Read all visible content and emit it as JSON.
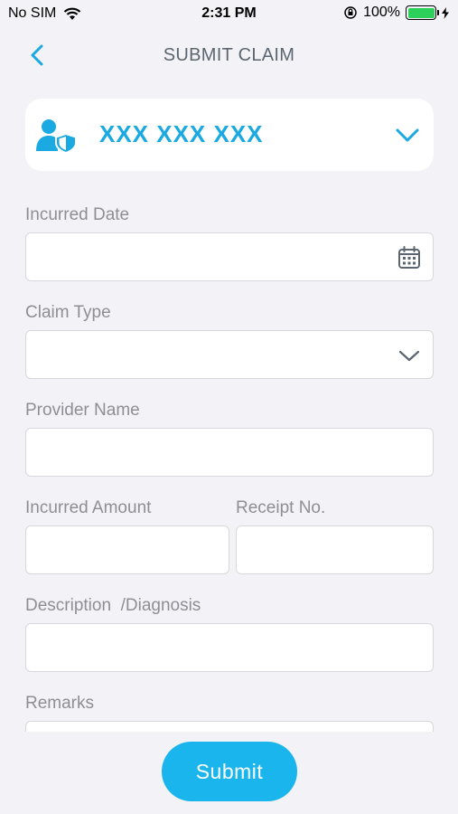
{
  "status_bar": {
    "carrier": "No SIM",
    "time": "2:31 PM",
    "battery_percent": "100%"
  },
  "nav": {
    "title": "SUBMIT CLAIM",
    "back_icon": "chevron-left-icon"
  },
  "member": {
    "name": "XXX XXX XXX",
    "icon": "user-shield-icon",
    "accent_color": "#1aa9e0"
  },
  "form": {
    "incurred_date_label": "Incurred Date",
    "incurred_date_value": "",
    "claim_type_label": "Claim Type",
    "claim_type_value": "",
    "provider_name_label": "Provider Name",
    "provider_name_value": "",
    "incurred_amount_label": "Incurred Amount",
    "incurred_amount_value": "",
    "receipt_no_label": "Receipt No.",
    "receipt_no_value": "",
    "description_label": "Description  /Diagnosis",
    "description_value": "",
    "remarks_label": "Remarks",
    "remarks_value": ""
  },
  "submit_label": "Submit",
  "colors": {
    "accent": "#1ab5ec",
    "background": "#f2f2f7"
  }
}
